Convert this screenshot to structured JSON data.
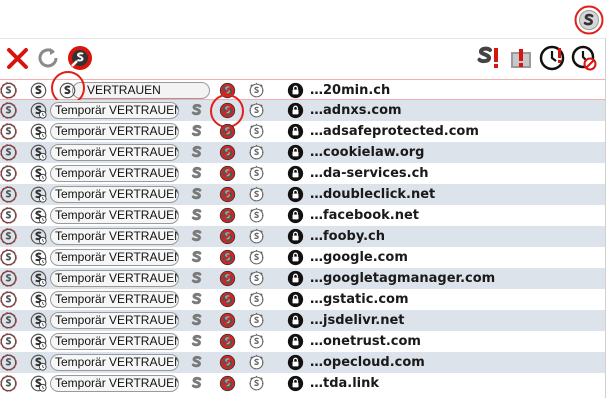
{
  "extension_button": {
    "icon": "noscript-icon"
  },
  "toolbar": {
    "close_icon": "close-icon",
    "reload_icon": "reload-icon",
    "options_icon": "options-icon",
    "global_toggle_icon": "noscript-global-icon",
    "xss_icon": "xss-alert-icon",
    "temp_allow_icon": "clock-allow-icon",
    "revoke_temp_icon": "clock-revoke-icon"
  },
  "first_row": {
    "trust_label": "VERTRAUEN",
    "domain": "…20min.ch"
  },
  "rows": [
    {
      "trust_label": "Temporär VERTRAUEN",
      "domain": "…adnxs.com"
    },
    {
      "trust_label": "Temporär VERTRAUEN",
      "domain": "…adsafeprotected.com"
    },
    {
      "trust_label": "Temporär VERTRAUEN",
      "domain": "…cookielaw.org"
    },
    {
      "trust_label": "Temporär VERTRAUEN",
      "domain": "…da-services.ch"
    },
    {
      "trust_label": "Temporär VERTRAUEN",
      "domain": "…doubleclick.net"
    },
    {
      "trust_label": "Temporär VERTRAUEN",
      "domain": "…facebook.net"
    },
    {
      "trust_label": "Temporär VERTRAUEN",
      "domain": "…fooby.ch"
    },
    {
      "trust_label": "Temporär VERTRAUEN",
      "domain": "…google.com"
    },
    {
      "trust_label": "Temporär VERTRAUEN",
      "domain": "…googletagmanager.com"
    },
    {
      "trust_label": "Temporär VERTRAUEN",
      "domain": "…gstatic.com"
    },
    {
      "trust_label": "Temporär VERTRAUEN",
      "domain": "…jsdelivr.net"
    },
    {
      "trust_label": "Temporär VERTRAUEN",
      "domain": "…onetrust.com"
    },
    {
      "trust_label": "Temporär VERTRAUEN",
      "domain": "…opecloud.com"
    },
    {
      "trust_label": "Temporär VERTRAUEN",
      "domain": "…tda.link"
    }
  ],
  "colors": {
    "accent_red": "#e0201a",
    "row_alt": "#dde3ea",
    "gray_icon": "#7a7a7a"
  }
}
